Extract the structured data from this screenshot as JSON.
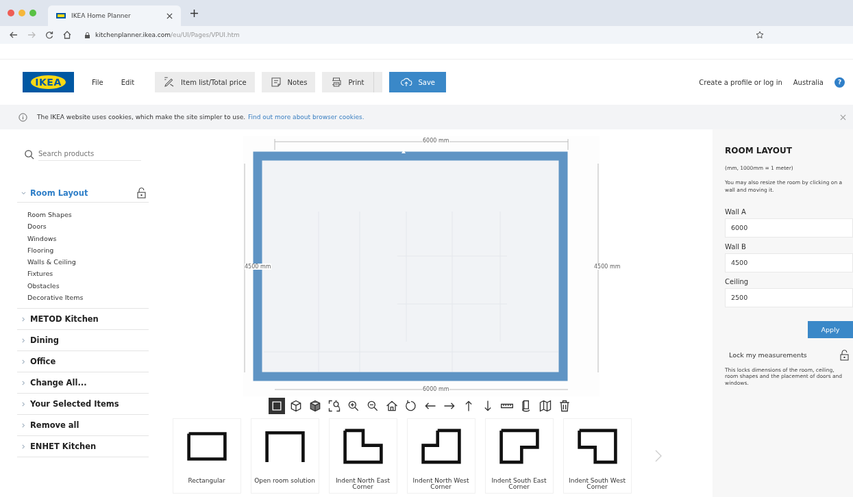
{
  "browser": {
    "tab_title": "IKEA Home Planner",
    "url_host": "kitchenplanner.ikea.com",
    "url_path": "/eu/UI/Pages/VPUI.htm"
  },
  "header": {
    "logo": "IKEA",
    "menu": [
      "File",
      "Edit"
    ],
    "actions": [
      {
        "kind": "list",
        "label": "Item list/Total price"
      },
      {
        "kind": "notes",
        "label": "Notes"
      },
      {
        "kind": "print",
        "label": "Print"
      },
      {
        "kind": "save",
        "label": "Save"
      }
    ],
    "account": "Create a profile or log in",
    "country": "Australia",
    "help": "?"
  },
  "cookie_bar": {
    "text": "The IKEA website uses cookies, which make the site simpler to use.",
    "link": "Find out more about browser cookies."
  },
  "sidebar": {
    "search": {
      "placeholder": "Search products"
    },
    "sections": [
      {
        "label": "Room Layout",
        "expanded": true,
        "children": [
          "Room Shapes",
          "Doors",
          "Windows",
          "Flooring",
          "Walls & Ceiling",
          "Fixtures",
          "Obstacles",
          "Decorative Items"
        ]
      },
      {
        "label": "METOD Kitchen",
        "expanded": false
      },
      {
        "label": "Dining",
        "expanded": false
      },
      {
        "label": "Office",
        "expanded": false
      },
      {
        "label": "Change All...",
        "expanded": false
      },
      {
        "label": "Your Selected Items",
        "expanded": false
      },
      {
        "label": "Remove all",
        "expanded": false
      },
      {
        "label": "ENHET Kitchen",
        "expanded": false
      }
    ]
  },
  "canvas": {
    "dimensions": {
      "top": "6000 mm",
      "left": "4500 mm",
      "right": "4500 mm",
      "bottom": "6000 mm"
    },
    "tools": [
      {
        "kind": "plan",
        "selected": true
      },
      {
        "kind": "cube",
        "selected": false
      },
      {
        "kind": "solid",
        "selected": false
      },
      {
        "kind": "fit",
        "selected": false
      },
      {
        "kind": "zoomin",
        "selected": false
      },
      {
        "kind": "zoomout",
        "selected": false
      },
      {
        "kind": "home",
        "selected": false
      },
      {
        "kind": "rotate",
        "selected": false
      },
      {
        "kind": "left",
        "selected": false
      },
      {
        "kind": "right",
        "selected": false
      },
      {
        "kind": "up",
        "selected": false
      },
      {
        "kind": "down",
        "selected": false
      },
      {
        "kind": "ruler",
        "selected": false
      },
      {
        "kind": "turn",
        "selected": false
      },
      {
        "kind": "walls",
        "selected": false
      },
      {
        "kind": "trash",
        "selected": false
      }
    ],
    "shapes": [
      {
        "kind": "rectangular",
        "label": "Rectangular"
      },
      {
        "kind": "open",
        "label": "Open room solution"
      },
      {
        "kind": "indent-ne",
        "label": "Indent North East Corner"
      },
      {
        "kind": "indent-nw",
        "label": "Indent North West Corner"
      },
      {
        "kind": "indent-se",
        "label": "Indent South East Corner"
      },
      {
        "kind": "indent-sw",
        "label": "Indent South West Corner"
      }
    ]
  },
  "panel": {
    "title": "ROOM LAYOUT",
    "units": "(mm, 1000mm = 1 meter)",
    "hint": "You may also resize the room by clicking on a wall and moving it.",
    "fields": [
      {
        "label": "Wall A",
        "value": "6000"
      },
      {
        "label": "Wall B",
        "value": "4500"
      },
      {
        "label": "Ceiling",
        "value": "2500"
      }
    ],
    "apply": "Apply",
    "lock_label": "Lock my measurements",
    "lock_note": "This locks dimensions of the room, ceiling, room shapes and the placement of doors and windows."
  }
}
